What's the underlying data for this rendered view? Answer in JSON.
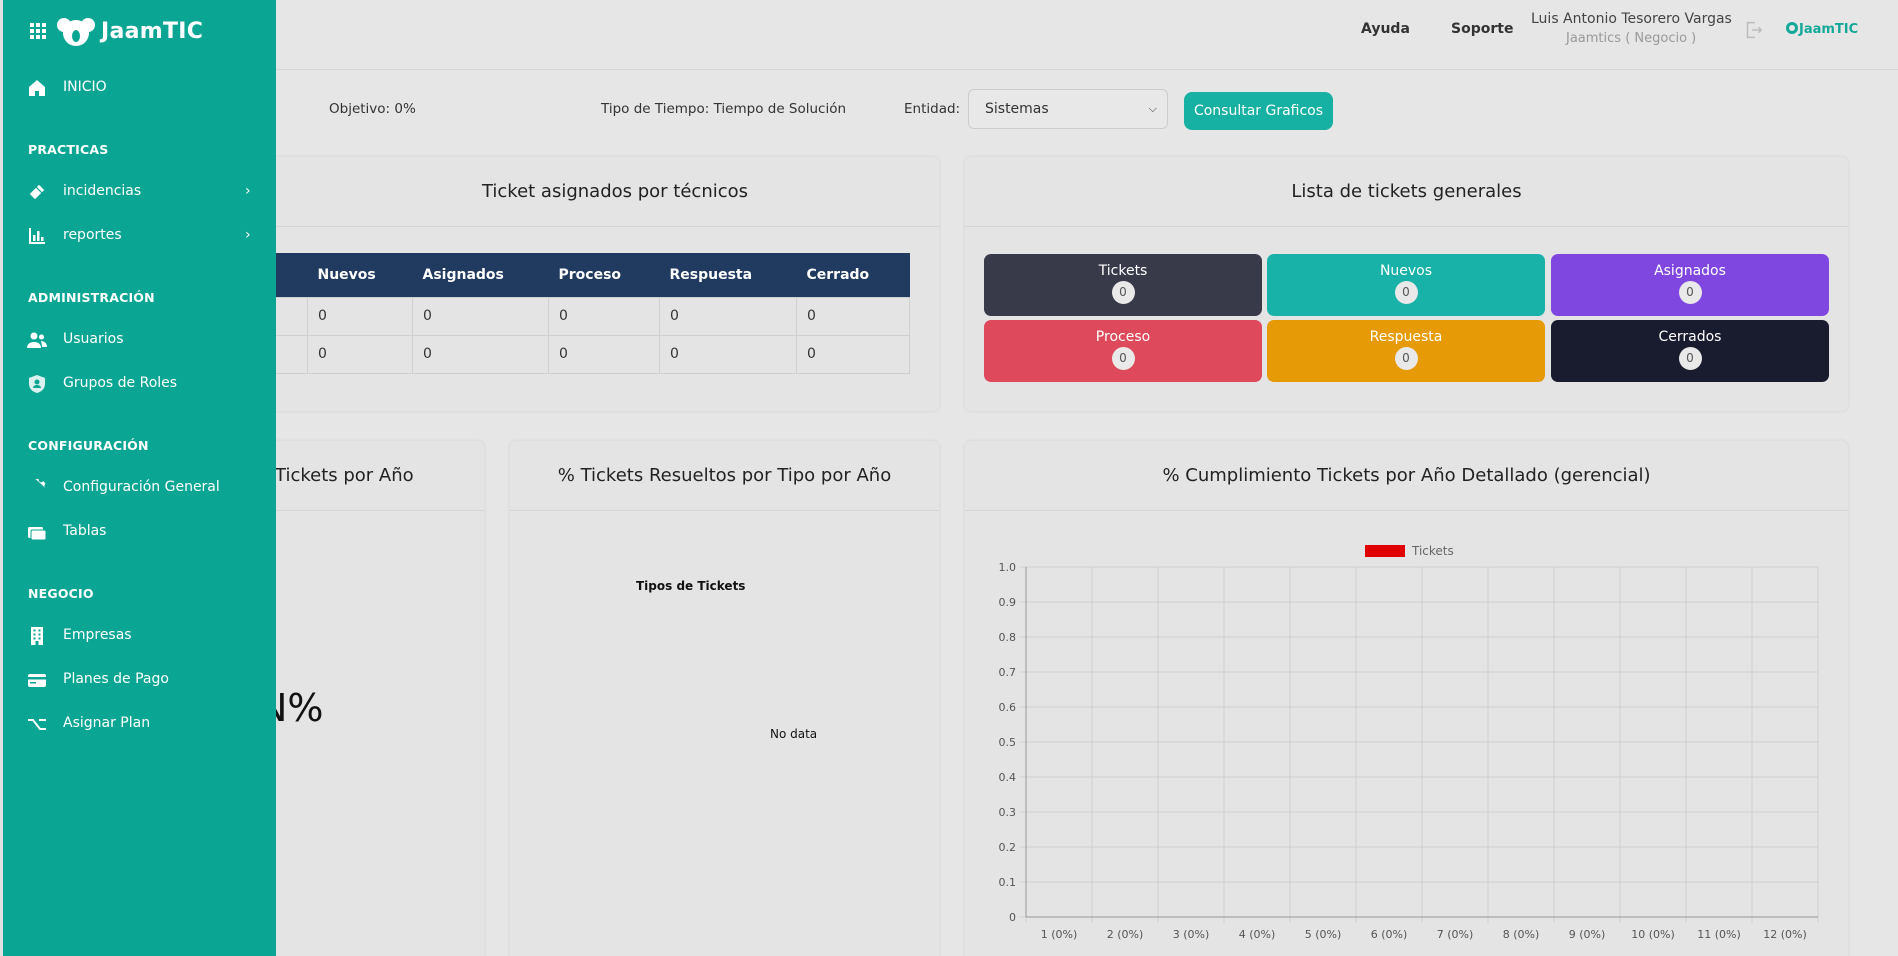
{
  "header": {
    "help_label": "Ayuda",
    "support_label": "Soporte",
    "user_name": "Luis Antonio Tesorero Vargas",
    "user_org": "Jaamtics ( Negocio )",
    "mini_logo": "JaamTIC"
  },
  "filters": {
    "objetivo_label": "Objetivo:",
    "objetivo_value": "0%",
    "tipo_tiempo_label": "Tipo de Tiempo:",
    "tipo_tiempo_value": "Tiempo de Solución",
    "entidad_label": "Entidad:",
    "entidad_selected": "Sistemas",
    "consultar_label": "Consultar Graficos"
  },
  "tech_card": {
    "title": "Ticket asignados por técnicos",
    "columns": [
      "Nuevos",
      "Asignados",
      "Proceso",
      "Respuesta",
      "Cerrado"
    ],
    "rows": [
      [
        "0",
        "0",
        "0",
        "0",
        "0"
      ],
      [
        "0",
        "0",
        "0",
        "0",
        "0"
      ]
    ]
  },
  "tickets_card": {
    "title": "Lista de tickets generales",
    "tiles": [
      {
        "label": "Tickets",
        "count": "0",
        "color": "#383a4a"
      },
      {
        "label": "Nuevos",
        "count": "0",
        "color": "#18b2a8"
      },
      {
        "label": "Asignados",
        "count": "0",
        "color": "#7f46e0"
      },
      {
        "label": "Proceso",
        "count": "0",
        "color": "#de4a5c"
      },
      {
        "label": "Respuesta",
        "count": "0",
        "color": "#e69a05"
      },
      {
        "label": "Cerrados",
        "count": "0",
        "color": "#191b2e"
      }
    ]
  },
  "anual_card": {
    "title_partial": "Tickets por Año",
    "value_partial": "N%"
  },
  "tipo_card": {
    "title": "% Tickets Resueltos por Tipo por Año",
    "chart_title": "Tipos de Tickets",
    "no_data": "No data"
  },
  "cumplimiento_card": {
    "title": "% Cumplimiento Tickets por Año Detallado (gerencial)"
  },
  "chart_data": {
    "type": "bar",
    "title": "",
    "categories": [
      "1 (0%)",
      "2 (0%)",
      "3 (0%)",
      "4 (0%)",
      "5 (0%)",
      "6 (0%)",
      "7 (0%)",
      "8 (0%)",
      "9 (0%)",
      "10 (0%)",
      "11 (0%)",
      "12 (0%)"
    ],
    "series": [
      {
        "name": "Tickets",
        "values": [
          0,
          0,
          0,
          0,
          0,
          0,
          0,
          0,
          0,
          0,
          0,
          0
        ],
        "color": "#e00000"
      }
    ],
    "y_ticks": [
      "0",
      "0.1",
      "0.2",
      "0.3",
      "0.4",
      "0.5",
      "0.6",
      "0.7",
      "0.8",
      "0.9",
      "1.0"
    ],
    "ylim": [
      0,
      1
    ],
    "grid": true,
    "legend": "top"
  },
  "sidebar": {
    "logo_text": "JaamTIC",
    "inicio": "INICIO",
    "sections": {
      "practicas": "PRACTICAS",
      "administracion": "ADMINISTRACIÓN",
      "configuracion": "CONFIGURACIÓN",
      "negocio": "NEGOCIO"
    },
    "items": {
      "incidencias": "incidencias",
      "reportes": "reportes",
      "usuarios": "Usuarios",
      "grupos_roles": "Grupos de Roles",
      "config_general": "Configuración General",
      "tablas": "Tablas",
      "empresas": "Empresas",
      "planes_pago": "Planes de Pago",
      "asignar_plan": "Asignar Plan"
    }
  },
  "colors": {
    "sidebar": "#0ba594",
    "accent": "#17b1a3",
    "table_header": "#213a5f"
  }
}
